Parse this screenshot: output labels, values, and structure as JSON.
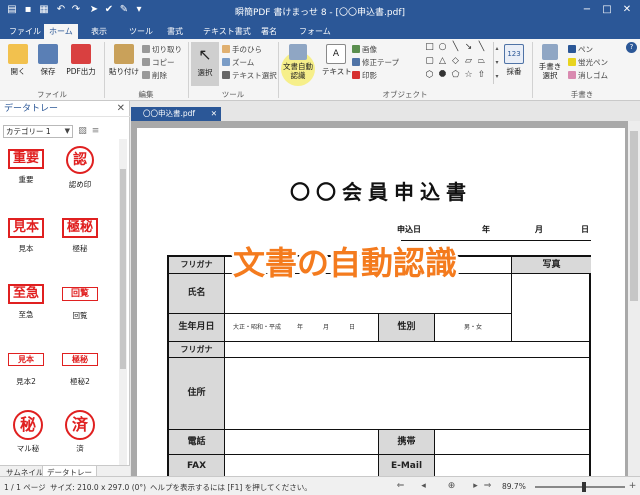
{
  "app": {
    "title": "瞬簡PDF 書けまっせ 8 - [〇〇申込書.pdf]",
    "quick_access_icons": [
      "printer-icon",
      "save-icon",
      "save-as-icon",
      "undo-icon",
      "redo-icon",
      "select-cursor-icon",
      "check-icon",
      "edit-icon",
      "dropdown-icon"
    ],
    "window_buttons": {
      "minimize": "−",
      "restore": "□",
      "close": "✕"
    }
  },
  "menu": {
    "tabs": [
      "ファイル",
      "ホーム",
      "表示",
      "ツール",
      "書式",
      "テキスト書式",
      "署名",
      "フォーム"
    ],
    "active": "ホーム"
  },
  "ribbon": {
    "file_group": {
      "open": "開く",
      "save": "保存",
      "pdf_out": "PDF出力",
      "label": "ファイル"
    },
    "edit_group": {
      "paste": "貼り付け",
      "cut": "切り取り",
      "copy": "コピー",
      "delete": "削除",
      "label": "編集"
    },
    "tool_group": {
      "select": "選択",
      "hand": "手のひら",
      "zoom": "ズーム",
      "text_select": "テキスト選択",
      "label": "ツール"
    },
    "object_group": {
      "auto_detect": "文書自動認識",
      "text": "テキスト",
      "image": "画像",
      "correction_tape": "修正テープ",
      "stamp": "印影",
      "label": "オブジェクト",
      "number_icon": "123",
      "numbering": "採番"
    },
    "handwrite_group": {
      "handwrite_select": "手書き選択",
      "pen": "ペン",
      "highlighter": "蛍光ペン",
      "eraser": "消しゴム",
      "label": "手書き"
    },
    "help_icon": "?"
  },
  "data_tray": {
    "title": "データトレー",
    "category": "カテゴリー 1",
    "stamps": [
      {
        "text": "重要",
        "label": "重要",
        "style": "rect"
      },
      {
        "text": "認",
        "label": "認め印",
        "style": "circle"
      },
      {
        "text": "見本",
        "label": "見本",
        "style": "rect"
      },
      {
        "text": "極秘",
        "label": "極秘",
        "style": "rect"
      },
      {
        "text": "至急",
        "label": "至急",
        "style": "rect"
      },
      {
        "text": "回覧",
        "label": "回覧",
        "style": "rect-thin"
      },
      {
        "text": "見本",
        "label": "見本2",
        "style": "rect-thin"
      },
      {
        "text": "極秘",
        "label": "極秘2",
        "style": "rect-thin"
      },
      {
        "text": "秘",
        "label": "マル秘",
        "style": "circle"
      },
      {
        "text": "済",
        "label": "済",
        "style": "circle"
      }
    ],
    "bottom_tabs": [
      "サムネイル",
      "データトレー"
    ],
    "active_tab": "データトレー"
  },
  "document": {
    "tab_label": "〇〇申込書.pdf",
    "title": "〇〇会員申込書",
    "apply_date": "申込日",
    "year": "年",
    "month": "月",
    "day": "日",
    "form": {
      "furigana": "フリガナ",
      "name": "氏名",
      "photo": "写真",
      "birthdate": "生年月日",
      "era": "大正・昭和・平成",
      "b_year": "年",
      "b_month": "月",
      "b_day": "日",
      "gender": "性別",
      "gender_opts": "男・女",
      "furigana2": "フリガナ",
      "address": "住所",
      "phone": "電話",
      "mobile": "携帯",
      "fax": "FAX",
      "email": "E-Mail"
    },
    "overlay_caption": "文書の自動認識"
  },
  "status": {
    "pages": "1 / 1 ページ",
    "size": "サイズ: 210.0 x 297.0 (0°)",
    "help": "ヘルプを表示するには [F1] を押してください。",
    "zoom": "89.7%"
  },
  "colors": {
    "title_bar": "#2b5797",
    "stamp_red": "#e02020",
    "overlay_orange": "#f47b1e",
    "form_label_gray": "#d9d9d9"
  }
}
